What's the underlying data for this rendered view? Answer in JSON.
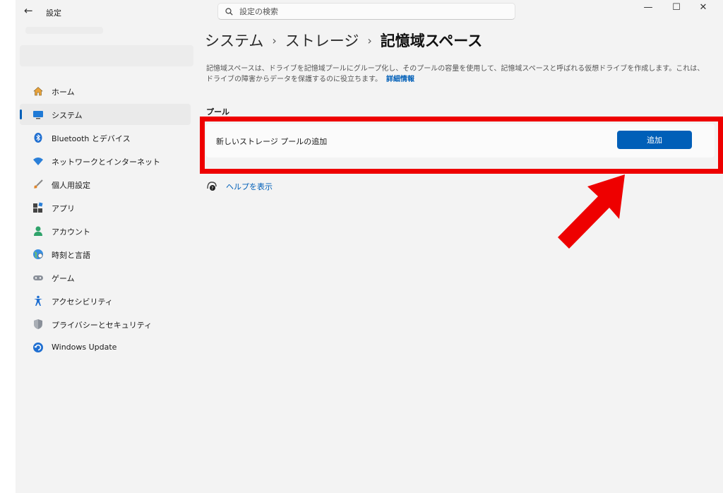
{
  "titlebar": {
    "back_icon": "←",
    "app_title": "設定",
    "search_placeholder": "設定の検索",
    "minimize": "—",
    "maximize": "☐",
    "close": "✕"
  },
  "sidebar": {
    "items": [
      {
        "label": "ホーム",
        "icon": "home-icon"
      },
      {
        "label": "システム",
        "icon": "system-display-icon",
        "selected": true
      },
      {
        "label": "Bluetooth とデバイス",
        "icon": "bluetooth-icon"
      },
      {
        "label": "ネットワークとインターネット",
        "icon": "wifi-icon"
      },
      {
        "label": "個人用設定",
        "icon": "brush-icon"
      },
      {
        "label": "アプリ",
        "icon": "apps-icon"
      },
      {
        "label": "アカウント",
        "icon": "account-icon"
      },
      {
        "label": "時刻と言語",
        "icon": "globe-clock-icon"
      },
      {
        "label": "ゲーム",
        "icon": "gamepad-icon"
      },
      {
        "label": "アクセシビリティ",
        "icon": "accessibility-icon"
      },
      {
        "label": "プライバシーとセキュリティ",
        "icon": "shield-icon"
      },
      {
        "label": "Windows Update",
        "icon": "windows-update-icon"
      }
    ]
  },
  "breadcrumb": {
    "item1": "システム",
    "item2": "ストレージ",
    "current": "記憶域スペース",
    "separator": "›"
  },
  "description": {
    "text": "記憶域スペースは、ドライブを記憶域プールにグループ化し、そのプールの容量を使用して、記憶域スペースと呼ばれる仮想ドライブを作成します。これは、ドライブの障害からデータを保護するのに役立ちます。",
    "link": "詳細情報"
  },
  "pool_section": {
    "heading": "プール",
    "card_text": "新しいストレージ プールの追加",
    "add_button": "追加"
  },
  "help": {
    "label": "ヘルプを表示"
  },
  "annotation": {
    "highlight_color": "#ee0000",
    "arrow_color": "#ee0000"
  },
  "colors": {
    "accent": "#005fb8",
    "background": "#f3f3f3"
  }
}
